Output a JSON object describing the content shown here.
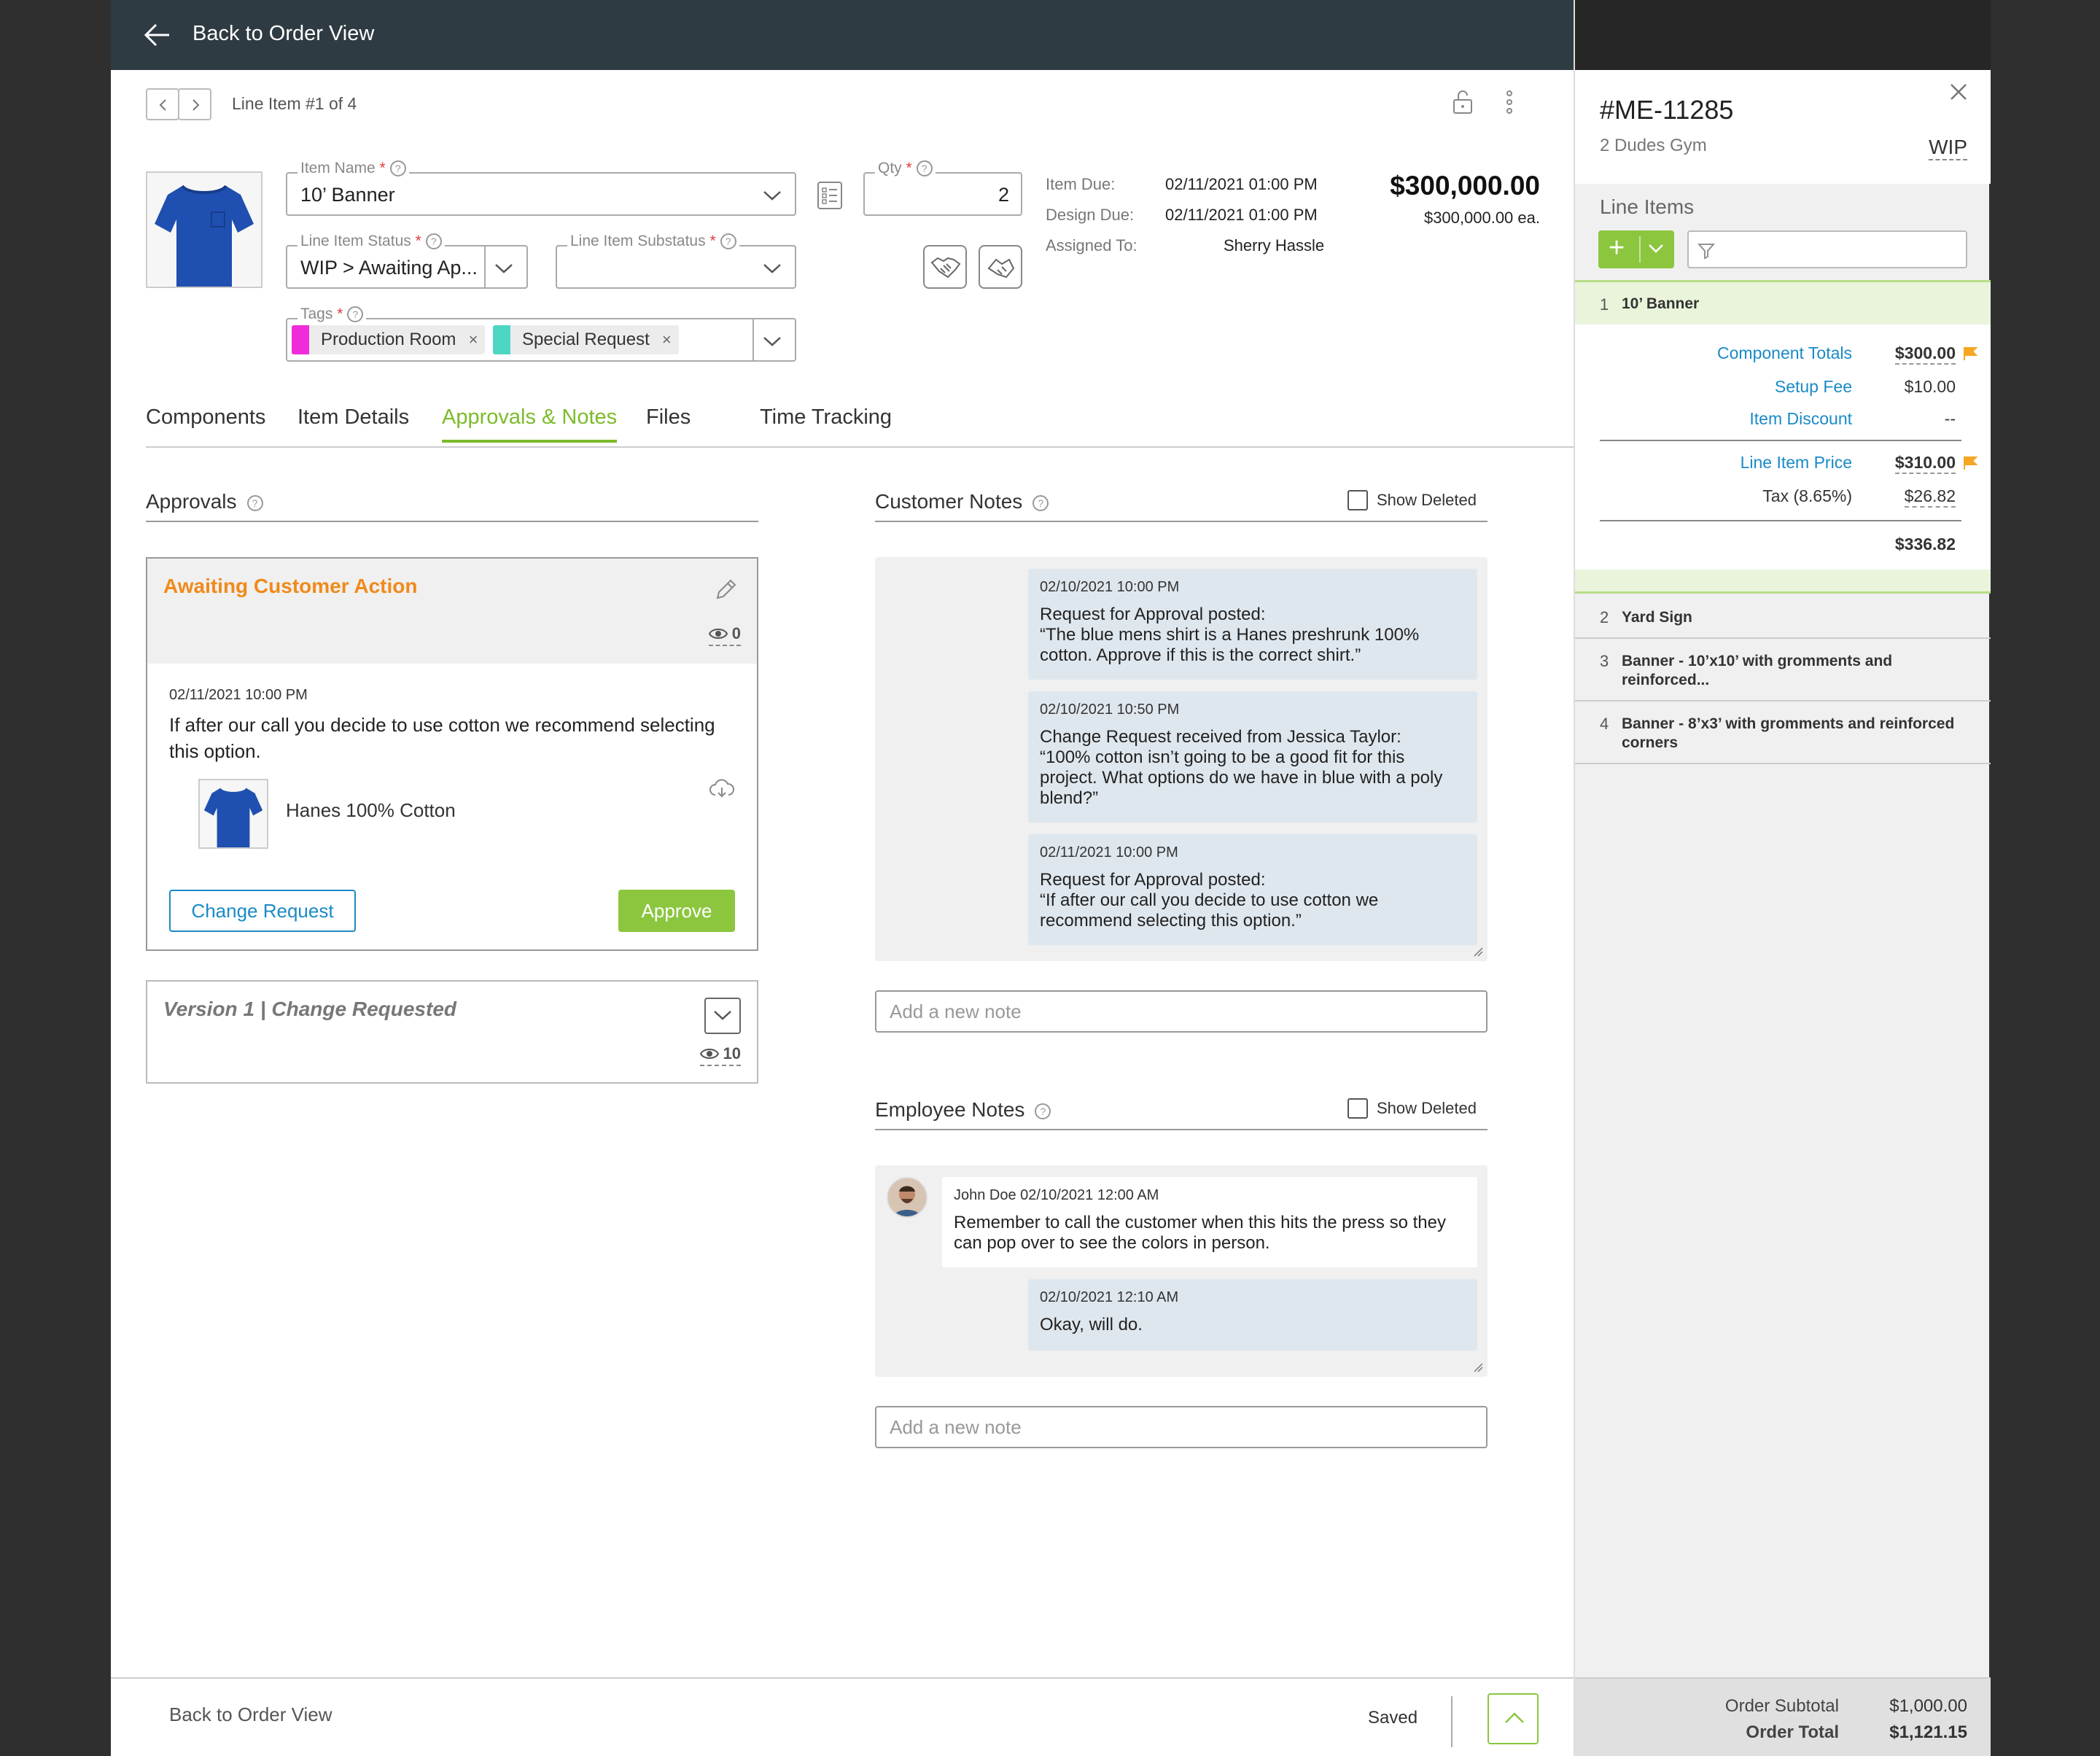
{
  "topbar": {
    "back_label": "Back to Order View"
  },
  "line_item_nav": {
    "counter": "Line Item #1 of 4"
  },
  "fields": {
    "item_name": {
      "label": "Item Name",
      "required": "*",
      "value": "10’ Banner"
    },
    "qty": {
      "label": "Qty",
      "required": "*",
      "value": "2"
    },
    "status": {
      "label": "Line Item Status",
      "required": "*",
      "value": "WIP > Awaiting Ap..."
    },
    "substatus": {
      "label": "Line Item Substatus",
      "required": "*",
      "value": ""
    },
    "tags": {
      "label": "Tags",
      "required": "*",
      "items": [
        {
          "label": "Production Room",
          "color": "#f02bd9"
        },
        {
          "label": "Special Request",
          "color": "#4dd6c3"
        }
      ]
    }
  },
  "meta": {
    "item_due_label": "Item Due:",
    "item_due": "02/11/2021 01:00 PM",
    "design_due_label": "Design Due:",
    "design_due": "02/11/2021 01:00 PM",
    "assigned_label": "Assigned To:",
    "assigned": "Sherry Hassle"
  },
  "price": {
    "total": "$300,000.00",
    "each": "$300,000.00 ea."
  },
  "tabs": [
    "Components",
    "Item Details",
    "Approvals & Notes",
    "Files",
    "Time Tracking"
  ],
  "approvals": {
    "title": "Approvals",
    "card": {
      "status": "Awaiting Customer Action",
      "views": "0",
      "date": "02/11/2021 10:00 PM",
      "message": "If after our call you decide to use cotton we recommend selecting this option.",
      "product": "Hanes 100% Cotton",
      "change_request": "Change Request",
      "approve": "Approve"
    },
    "version": {
      "title": "Version 1 | Change Requested",
      "views": "10"
    }
  },
  "customer_notes": {
    "title": "Customer Notes",
    "show_deleted": "Show Deleted",
    "notes": [
      {
        "time": "02/10/2021 10:00 PM",
        "text": "Request for Approval posted:\n“The blue mens shirt is a Hanes preshrunk 100% cotton. Approve if this is the correct shirt.”"
      },
      {
        "time": "02/10/2021 10:50 PM",
        "text": "Change Request received from Jessica Taylor:\n“100% cotton isn’t going to be a good fit for this project. What options do we have in blue with a poly blend?”"
      },
      {
        "time": "02/11/2021 10:00 PM",
        "text": "Request for Approval posted:\n“If after our call you decide to use cotton we recommend selecting this option.”"
      }
    ],
    "placeholder": "Add a new note"
  },
  "employee_notes": {
    "title": "Employee Notes",
    "show_deleted": "Show Deleted",
    "notes": [
      {
        "header": "John Doe 02/10/2021 12:00 AM",
        "text": "Remember to call the customer when this hits the press so they can pop over to see the colors in person."
      },
      {
        "header": "02/10/2021 12:10 AM",
        "text": "Okay, will do."
      }
    ],
    "placeholder": "Add a new note"
  },
  "footer": {
    "back": "Back to Order View",
    "saved": "Saved"
  },
  "side": {
    "order_number": "#ME-11285",
    "customer": "2 Dudes Gym",
    "status": "WIP",
    "line_items_title": "Line Items",
    "add": "+",
    "expanded": {
      "num": "1",
      "name": "10’ Banner",
      "rows": [
        {
          "label": "Component Totals",
          "value": "$300.00"
        },
        {
          "label": "Setup Fee",
          "value": "$10.00"
        },
        {
          "label": "Item Discount",
          "value": "--"
        },
        {
          "label": "Line Item Price",
          "value": "$310.00"
        },
        {
          "label": "Tax (8.65%)",
          "value": "$26.82"
        }
      ],
      "total": "$336.82"
    },
    "items": [
      {
        "num": "2",
        "name": "Yard Sign"
      },
      {
        "num": "3",
        "name": "Banner - 10’x10’ with gromments and reinforced..."
      },
      {
        "num": "4",
        "name": "Banner - 8’x3’ with gromments and reinforced corners"
      }
    ],
    "order_subtotal_label": "Order Subtotal",
    "order_subtotal": "$1,000.00",
    "order_total_label": "Order Total",
    "order_total": "$1,121.15"
  },
  "colors": {
    "accent_green": "#8cc63f",
    "link_blue": "#1a8ac7",
    "status_orange": "#f08a1a",
    "topbar": "#2f3b42"
  }
}
